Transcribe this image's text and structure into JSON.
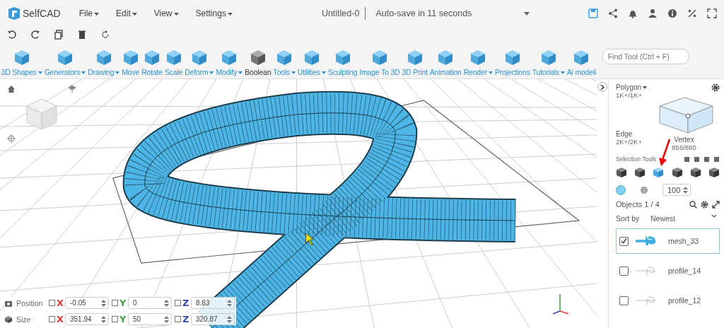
{
  "app": {
    "logo": "SelfCAD",
    "menus": [
      {
        "label": "File"
      },
      {
        "label": "Edit"
      },
      {
        "label": "View"
      },
      {
        "label": "Settings"
      }
    ],
    "title": "Untitled-0",
    "autosave": "Auto-save in 11 seconds"
  },
  "toolbar": {
    "tools": [
      {
        "label": "3D Shapes",
        "has_menu": true
      },
      {
        "label": "Generators",
        "has_menu": true
      },
      {
        "label": "Drawing",
        "has_menu": true
      },
      {
        "label": "Move",
        "has_menu": false
      },
      {
        "label": "Rotate",
        "has_menu": false
      },
      {
        "label": "Scale",
        "has_menu": false
      },
      {
        "label": "Deform",
        "has_menu": true
      },
      {
        "label": "Modify",
        "has_menu": true
      },
      {
        "label": "Boolean",
        "has_menu": false,
        "kind": "grey"
      },
      {
        "label": "Tools",
        "has_menu": true
      },
      {
        "label": "Utilities",
        "has_menu": true
      },
      {
        "label": "Sculpting",
        "has_menu": false
      },
      {
        "label": "Image To 3D",
        "has_menu": false
      },
      {
        "label": "3D Print",
        "has_menu": false
      },
      {
        "label": "Animation",
        "has_menu": false
      },
      {
        "label": "Render",
        "has_menu": true
      },
      {
        "label": "Projections",
        "has_menu": false
      },
      {
        "label": "Tutorials",
        "has_menu": true
      },
      {
        "label": "Ai modeli",
        "has_menu": false
      }
    ],
    "search": {
      "placeholder": "Find Tool (Ctrl + F)"
    }
  },
  "transform": {
    "rows": [
      {
        "kind": "position",
        "label": "Position",
        "axes": [
          {
            "axis": "X",
            "color": "#e53935",
            "value": "-0.05",
            "checked": false
          },
          {
            "axis": "Y",
            "color": "#43a047",
            "value": "0",
            "checked": false
          },
          {
            "axis": "Z",
            "color": "#3949ab",
            "value": "8.83",
            "checked": false
          }
        ]
      },
      {
        "kind": "size",
        "label": "Size",
        "axes": [
          {
            "axis": "X",
            "color": "#e53935",
            "value": "351.94",
            "checked": false
          },
          {
            "axis": "Y",
            "color": "#43a047",
            "value": "50",
            "checked": false
          },
          {
            "axis": "Z",
            "color": "#3949ab",
            "value": "320.87",
            "checked": false
          }
        ]
      }
    ]
  },
  "panel": {
    "polygon": {
      "label": "Polygon",
      "count": "1K+/1K+"
    },
    "edge": {
      "label": "Edge",
      "count": "2K+/2K+"
    },
    "vertex": {
      "label": "Vertex",
      "count": "856/880"
    },
    "selection_tools_label": "Selection Tools",
    "selection_modes": [
      {
        "selected": false
      },
      {
        "selected": false
      },
      {
        "selected": true
      },
      {
        "selected": false
      },
      {
        "selected": false
      },
      {
        "selected": false
      }
    ],
    "brush_size": "100",
    "objects_label": "Objects 1 / 4",
    "sort_label": "Sort by",
    "sort_value": "Newest",
    "objects": [
      {
        "name": "mesh_33",
        "checked": true,
        "selected": true
      },
      {
        "name": "profile_14",
        "checked": false,
        "selected": false
      },
      {
        "name": "profile_12",
        "checked": false,
        "selected": false
      }
    ]
  }
}
